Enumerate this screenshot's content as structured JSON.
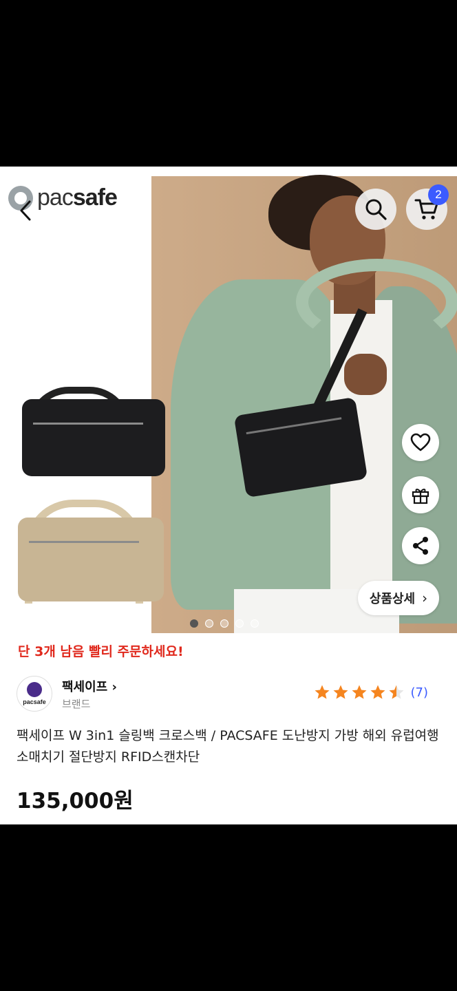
{
  "header": {
    "logo_text_left": "pac",
    "logo_text_right": "safe",
    "cart_count": "2"
  },
  "hero": {
    "detail_button": "상품상세",
    "slide_count": 5,
    "active_slide": 1
  },
  "product": {
    "stock_alert": "단 3개 남음 빨리 주문하세요!",
    "seller_name": "팩세이프",
    "seller_type": "브랜드",
    "seller_logo_text": "pacsafe",
    "rating": 4.5,
    "review_count": "(7)",
    "title": "팩세이프 W 3in1 슬링백 크로스백 / PACSAFE 도난방지 가방 해외 유럽여행 소매치기 절단방지 RFID스캔차단",
    "price": "135,000원"
  },
  "colors": {
    "accent_blue": "#3b5bff",
    "alert_red": "#e0281c",
    "star_orange": "#f5851f"
  }
}
